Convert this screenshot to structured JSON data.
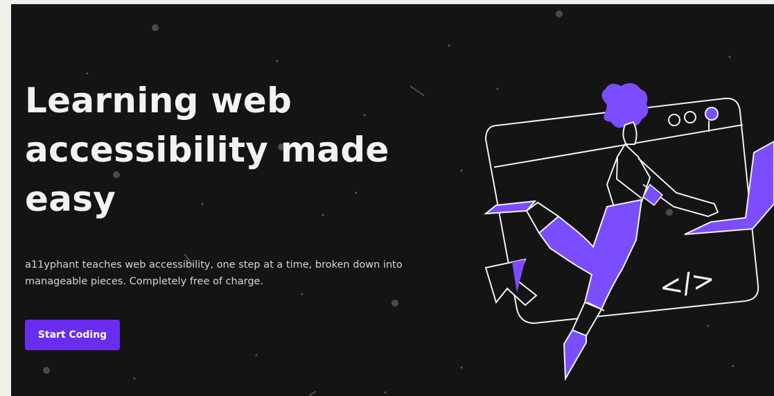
{
  "hero": {
    "headline_lines": [
      "Learning web",
      "accessibility made",
      "easy"
    ],
    "subtitle": "a11yphant teaches web accessibility, one step at a time, broken down into manageable pieces. Completely free of charge.",
    "cta_label": "Start Coding",
    "code_symbol": "</>"
  },
  "colors": {
    "background": "#141414",
    "page": "#f0efea",
    "accent": "#6a2cf0",
    "illustration_accent": "#7b4dff",
    "text": "#f2f2f2"
  },
  "icons": [
    "browser-window-icon",
    "cursor-arrow-icon",
    "laptop-icon",
    "code-icon"
  ]
}
